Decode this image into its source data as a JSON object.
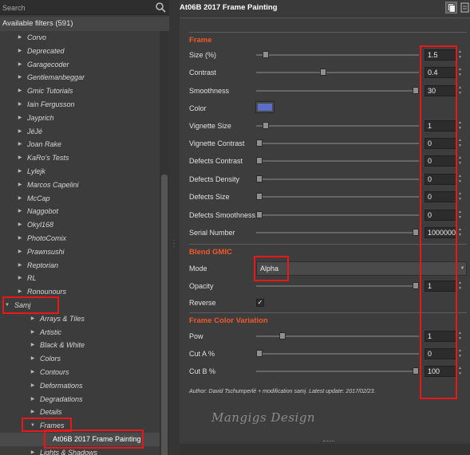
{
  "search": {
    "placeholder": "Search",
    "icon": "search-icon"
  },
  "filters_header": "Available filters (591)",
  "tree": [
    {
      "label": "Corvo",
      "arrow": "collapsed"
    },
    {
      "label": "Deprecated",
      "arrow": "collapsed"
    },
    {
      "label": "Garagecoder",
      "arrow": "collapsed"
    },
    {
      "label": "Gentlemanbeggar",
      "arrow": "collapsed"
    },
    {
      "label": "Gmic Tutorials",
      "arrow": "collapsed"
    },
    {
      "label": "Iain Fergusson",
      "arrow": "collapsed"
    },
    {
      "label": "Jayprich",
      "arrow": "collapsed"
    },
    {
      "label": "JéJé",
      "arrow": "collapsed"
    },
    {
      "label": "Joan Rake",
      "arrow": "collapsed"
    },
    {
      "label": "KaRo's Tests",
      "arrow": "collapsed"
    },
    {
      "label": "Lylejk",
      "arrow": "collapsed"
    },
    {
      "label": "Marcos Capelini",
      "arrow": "collapsed"
    },
    {
      "label": "McCap",
      "arrow": "collapsed"
    },
    {
      "label": "Naggobot",
      "arrow": "collapsed"
    },
    {
      "label": "Okyl168",
      "arrow": "collapsed"
    },
    {
      "label": "PhotoComix",
      "arrow": "collapsed"
    },
    {
      "label": "Prawnsushi",
      "arrow": "collapsed"
    },
    {
      "label": "Reptorian",
      "arrow": "collapsed"
    },
    {
      "label": "RL",
      "arrow": "collapsed"
    },
    {
      "label": "Ronounours",
      "arrow": "collapsed"
    },
    {
      "label": "Samj",
      "arrow": "expanded"
    },
    {
      "label": "Arrays & Tiles",
      "arrow": "collapsed"
    },
    {
      "label": "Artistic",
      "arrow": "collapsed"
    },
    {
      "label": "Black & White",
      "arrow": "collapsed"
    },
    {
      "label": "Colors",
      "arrow": "collapsed"
    },
    {
      "label": "Contours",
      "arrow": "collapsed"
    },
    {
      "label": "Deformations",
      "arrow": "collapsed"
    },
    {
      "label": "Degradations",
      "arrow": "collapsed"
    },
    {
      "label": "Details",
      "arrow": "collapsed"
    },
    {
      "label": "Frames",
      "arrow": "expanded"
    },
    {
      "label": "At06B 2017 Frame Painting",
      "arrow": "none",
      "selected": true
    },
    {
      "label": "Lights & Shadows",
      "arrow": "collapsed"
    }
  ],
  "filter_title": "At06B 2017 Frame Painting",
  "sections": {
    "frame": "Frame",
    "blend": "Blend GMIC",
    "variation": "Frame Color Variation"
  },
  "params": [
    {
      "label": "Size (%)",
      "value": "1.5",
      "fraction": 0.04
    },
    {
      "label": "Contrast",
      "value": "0.4",
      "fraction": 0.41
    },
    {
      "label": "Smoothness",
      "value": "30",
      "fraction": 1.0
    },
    {
      "label": "Color",
      "color": "#5a6ec8"
    },
    {
      "label": "Vignette Size",
      "value": "1",
      "fraction": 0.04
    },
    {
      "label": "Vignette Contrast",
      "value": "0",
      "fraction": 0.0
    },
    {
      "label": "Defects Contrast",
      "value": "0",
      "fraction": 0.0
    },
    {
      "label": "Defects Density",
      "value": "0",
      "fraction": 0.0
    },
    {
      "label": "Defects Size",
      "value": "0",
      "fraction": 0.0
    },
    {
      "label": "Defects Smoothness",
      "value": "0",
      "fraction": 0.0
    },
    {
      "label": "Serial Number",
      "value": "1000000",
      "fraction": 1.0
    },
    {
      "label": "Mode",
      "value": "Alpha"
    },
    {
      "label": "Opacity",
      "value": "1",
      "fraction": 1.0
    },
    {
      "label": "Reverse",
      "checked": true
    },
    {
      "label": "Pow",
      "value": "1",
      "fraction": 0.15
    },
    {
      "label": "Cut A %",
      "value": "0",
      "fraction": 0.0
    },
    {
      "label": "Cut B %",
      "value": "100",
      "fraction": 1.0
    }
  ],
  "author": "Author: David Tschumperlé + modification samj. Latest update: 2017/02/23.",
  "watermark": "Mangigs Design",
  "colors": {
    "accent": "#ef5a2a",
    "annotation": "#e81818",
    "swatch": "#5a6ec8"
  }
}
